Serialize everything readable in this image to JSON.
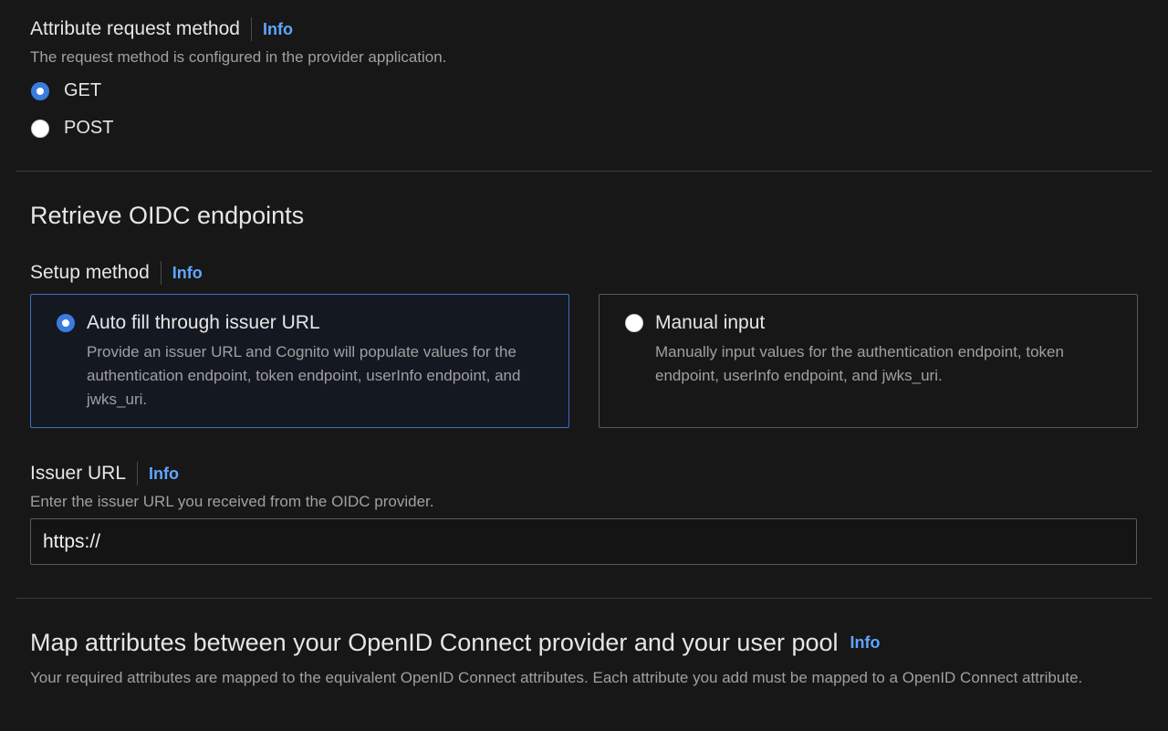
{
  "attribute_request_method": {
    "label": "Attribute request method",
    "info": "Info",
    "description": "The request method is configured in the provider application.",
    "options": [
      {
        "label": "GET",
        "selected": true
      },
      {
        "label": "POST",
        "selected": false
      }
    ]
  },
  "retrieve_oidc": {
    "title": "Retrieve OIDC endpoints",
    "setup_method": {
      "label": "Setup method",
      "info": "Info",
      "cards": [
        {
          "title": "Auto fill through issuer URL",
          "description": "Provide an issuer URL and Cognito will populate values for the authentication endpoint, token endpoint, userInfo endpoint, and jwks_uri.",
          "selected": true
        },
        {
          "title": "Manual input",
          "description": "Manually input values for the authentication endpoint, token endpoint, userInfo endpoint, and jwks_uri.",
          "selected": false
        }
      ]
    },
    "issuer_url": {
      "label": "Issuer URL",
      "info": "Info",
      "description": "Enter the issuer URL you received from the OIDC provider.",
      "value": "https://"
    }
  },
  "map_attributes": {
    "title": "Map attributes between your OpenID Connect provider and your user pool",
    "info": "Info",
    "description": "Your required attributes are mapped to the equivalent OpenID Connect attributes. Each attribute you add must be mapped to a OpenID Connect attribute."
  },
  "colors": {
    "background": "#171717",
    "accent": "#3b7bdc",
    "info_link": "#5fa6ff"
  }
}
